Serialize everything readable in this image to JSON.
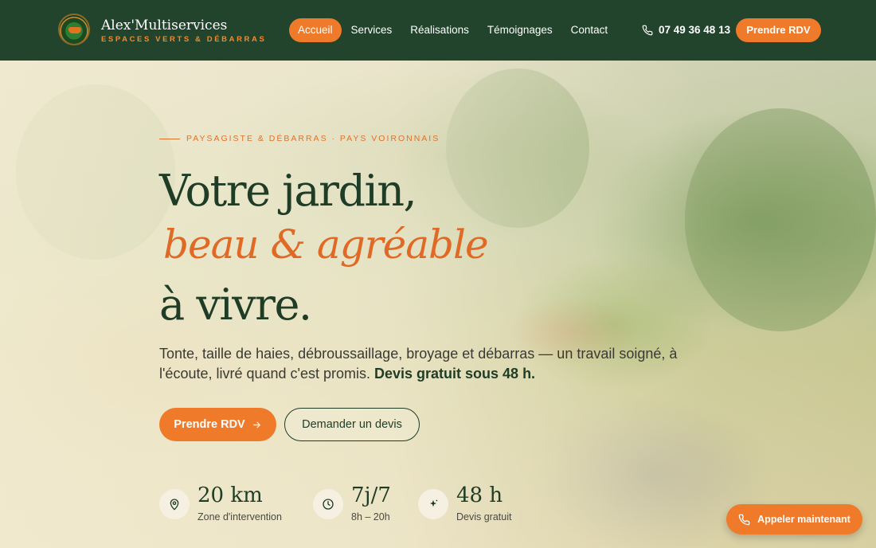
{
  "nav": {
    "brand_name": "Alex'Multiservices",
    "brand_tagline": "ESPACES VERTS & DÉBARRAS",
    "menu": [
      "Accueil",
      "Services",
      "Réalisations",
      "Témoignages",
      "Contact"
    ],
    "active_index": 0,
    "phone": "07 49 36 48 13",
    "cta": "Prendre RDV"
  },
  "hero": {
    "kicker": "PAYSAGISTE & DÉBARRAS · PAYS VOIRONNAIS",
    "title_line1": "Votre jardin,",
    "title_line2": "beau & agréable",
    "title_line3": "à vivre.",
    "lead_text": "Tonte, taille de haies, débroussaillage, broyage et débarras — un travail soigné, à l'écoute, livré quand c'est promis. ",
    "lead_bold": "Devis gratuit sous 48 h.",
    "primary_button": "Prendre RDV",
    "secondary_button": "Demander un devis"
  },
  "stats": [
    {
      "value": "20 km",
      "label": "Zone d'intervention",
      "icon": "location-pin-icon"
    },
    {
      "value": "7j/7",
      "label": "8h – 20h",
      "icon": "clock-icon"
    },
    {
      "value": "48 h",
      "label": "Devis gratuit",
      "icon": "sparkle-icon"
    }
  ],
  "floating_cta": "Appeler maintenant",
  "colors": {
    "nav_bg": "#22442c",
    "accent": "#ee7a2a",
    "heading": "#1f3d26"
  }
}
